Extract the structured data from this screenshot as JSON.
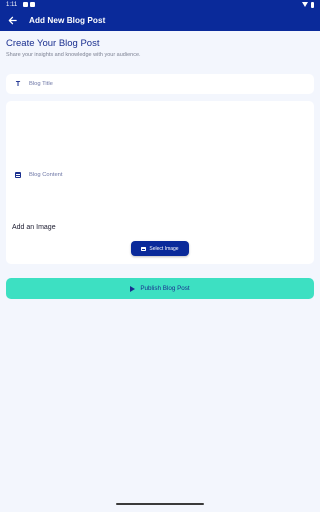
{
  "statusbar": {
    "time": "1:11"
  },
  "appbar": {
    "title": "Add New Blog Post"
  },
  "page": {
    "heading": "Create Your Blog Post",
    "subheading": "Share your insights and knowledge with your audience."
  },
  "form": {
    "title_placeholder": "Blog Title",
    "content_placeholder": "Blog Content",
    "image_label": "Add an Image",
    "select_image_label": "Select Image",
    "publish_label": "Publish Blog Post"
  },
  "colors": {
    "primary": "#0a2a9a",
    "accent": "#3de0c2",
    "background": "#f3f6fd"
  }
}
